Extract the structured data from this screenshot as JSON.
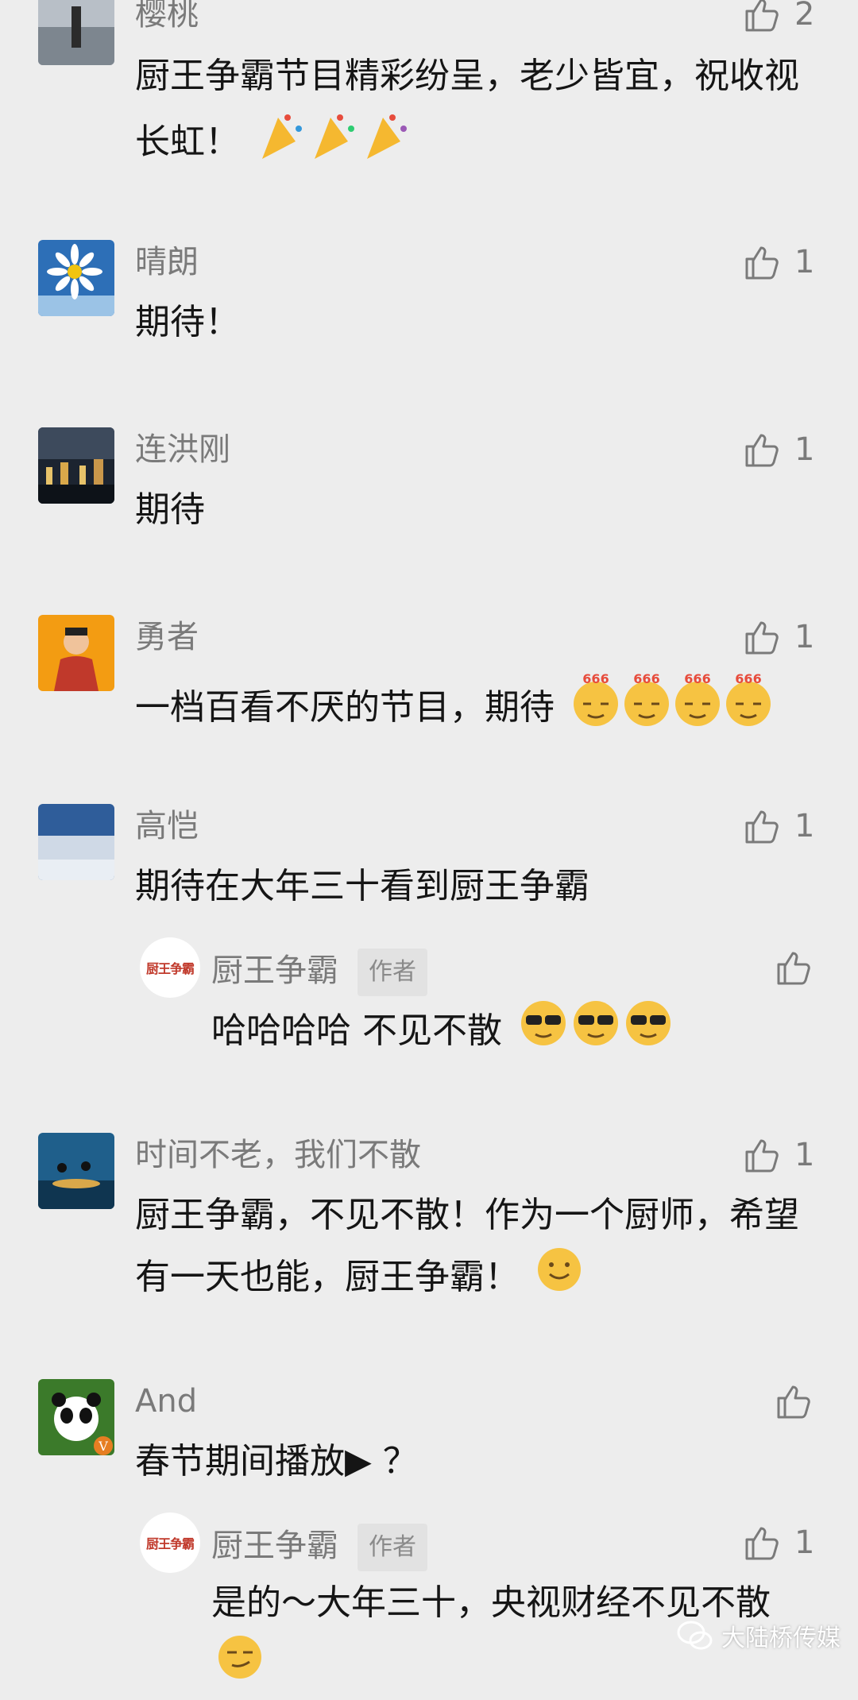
{
  "colors": {
    "background": "#ededed",
    "name": "#7a7a7a",
    "text": "#151515",
    "author_red": "#c0392b"
  },
  "comments": [
    {
      "name": "樱桃",
      "text": "厨王争霸节目精彩纷呈，老少皆宜，祝收视长虹！",
      "likes": "2",
      "emoji": "party-popper-icon"
    },
    {
      "name": "晴朗",
      "text": "期待！",
      "likes": "1"
    },
    {
      "name": "连洪刚",
      "text": "期待",
      "likes": "1"
    },
    {
      "name": "勇者",
      "text": "一档百看不厌的节目，期待",
      "likes": "1",
      "emoji": "666-emoji-icon"
    },
    {
      "name": "高恺",
      "text": "期待在大年三十看到厨王争霸",
      "likes": "1",
      "reply": {
        "name": "厨王争霸",
        "badge": "作者",
        "text": "哈哈哈哈 不见不散",
        "avatar_text": "厨王争霸",
        "emoji": "cool-sunglasses-icon"
      }
    },
    {
      "name": "时间不老，我们不散",
      "text": "厨王争霸，不见不散！作为一个厨师，希望有一天也能，厨王争霸！",
      "likes": "1",
      "emoji": "smile-icon"
    },
    {
      "name": "And",
      "text": "春节期间播放▶ ？",
      "likes": "",
      "reply": {
        "name": "厨王争霸",
        "badge": "作者",
        "text": "是的～大年三十，央视财经不见不散",
        "avatar_text": "厨王争霸",
        "likes": "1",
        "emoji": "smirk-icon"
      }
    }
  ],
  "watermark": {
    "text": "大陆桥传媒"
  }
}
